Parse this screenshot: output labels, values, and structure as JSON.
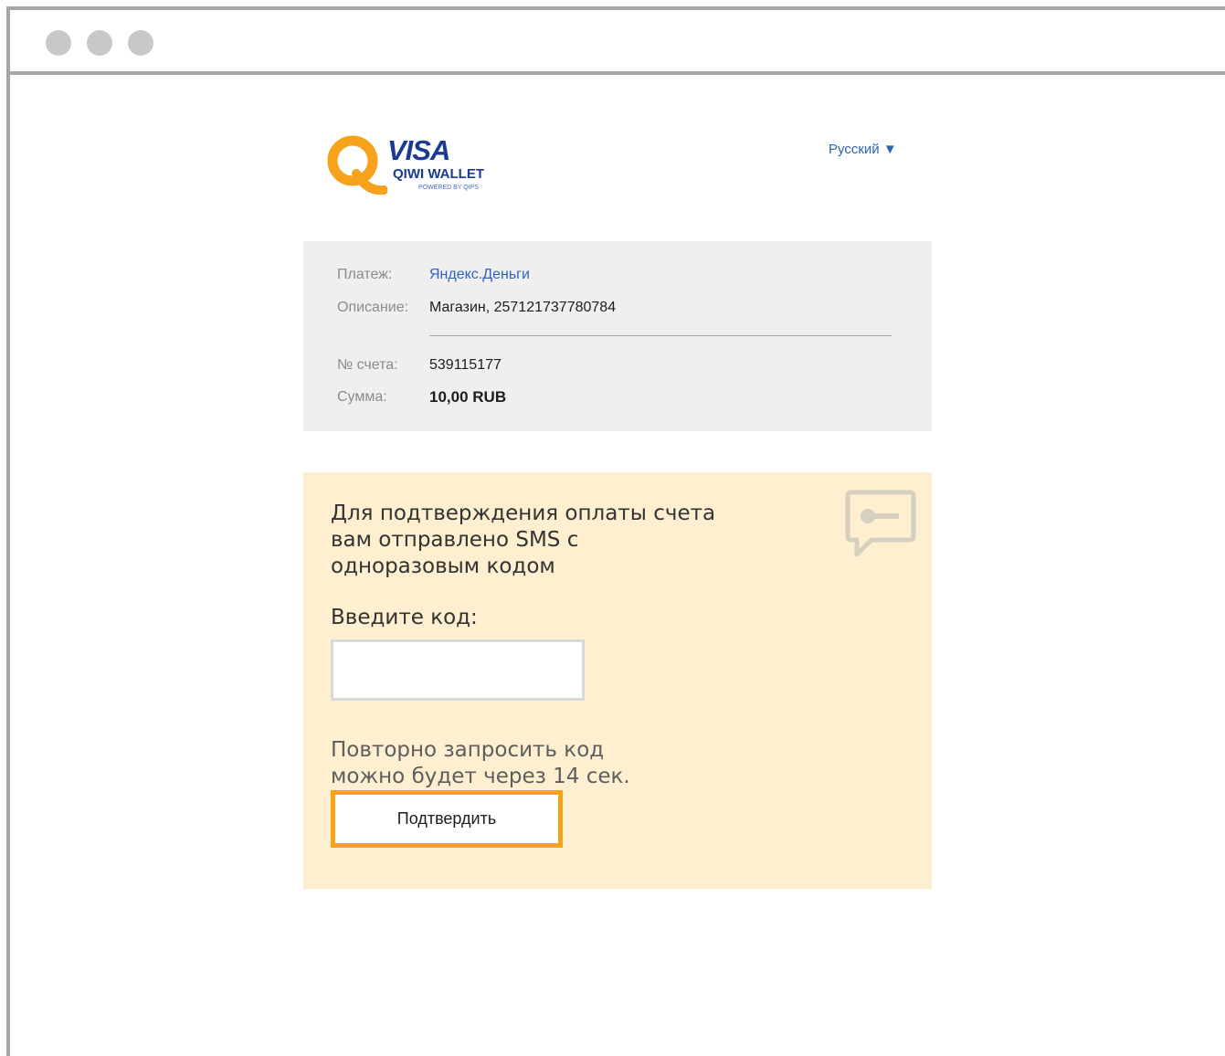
{
  "header": {
    "logo": {
      "brand": "VISA",
      "product": "QIWI WALLET",
      "tagline": "POWERED BY QIPS",
      "color": "#1a3b8f",
      "accent": "#f7a21b"
    },
    "language": "Русский ▼"
  },
  "payment": {
    "payee_label": "Платеж:",
    "payee_value": "Яндекс.Деньги",
    "description_label": "Описание:",
    "description_value": "Магазин, 257121737780784",
    "account_label": "№ счета:",
    "account_value": "539115177",
    "amount_label": "Сумма:",
    "amount_value": "10,00 RUB"
  },
  "sms_confirm": {
    "message_line1": "Для подтверждения оплаты счета",
    "message_line2": "вам отправлено SMS с",
    "message_line3": "одноразовым кодом",
    "code_label": "Введите код:",
    "code_value": "",
    "resend_line1": "Повторно запросить код",
    "resend_line2": "можно будет через 14 сек.",
    "confirm_button": "Подтвердить",
    "icon": "sms-key-icon",
    "panel_color": "#fdefd0"
  }
}
